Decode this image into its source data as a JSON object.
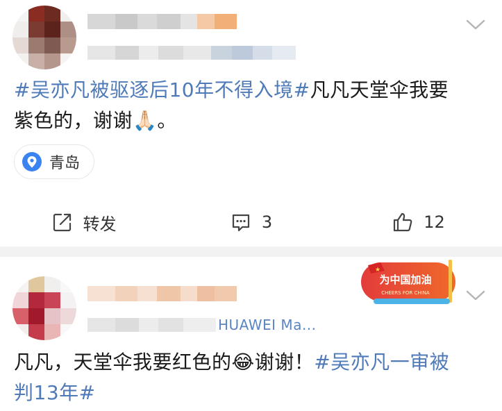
{
  "post1": {
    "content": {
      "hashtag": "#吴亦凡被驱逐后10年不得入境#",
      "line1_text": "凡凡天堂伞我要",
      "line2_text": "紫色的，谢谢",
      "emoji": "🙏🏻",
      "line2_end": "。"
    },
    "location": {
      "icon": "location-pin-icon",
      "label": "青岛"
    },
    "actions": {
      "repost_label": "转发",
      "comment_count": "3",
      "like_count": "12"
    }
  },
  "post2": {
    "device": "HUAWEI Ma...",
    "badge": {
      "title": "为中国加油",
      "subtitle": "CHEERS FOR CHINA"
    },
    "content": {
      "line1_text": "凡凡，天堂伞我要红色的",
      "emoji": "😂",
      "line1_after": "谢谢！",
      "hashtag_part1": "#吴亦凡一审被",
      "hashtag_part2": "判13年#"
    }
  },
  "colors": {
    "link": "#4f7ab8",
    "device": "#5b84c4",
    "separator": "#f2f2f2",
    "location_icon": "#3b83f0"
  }
}
